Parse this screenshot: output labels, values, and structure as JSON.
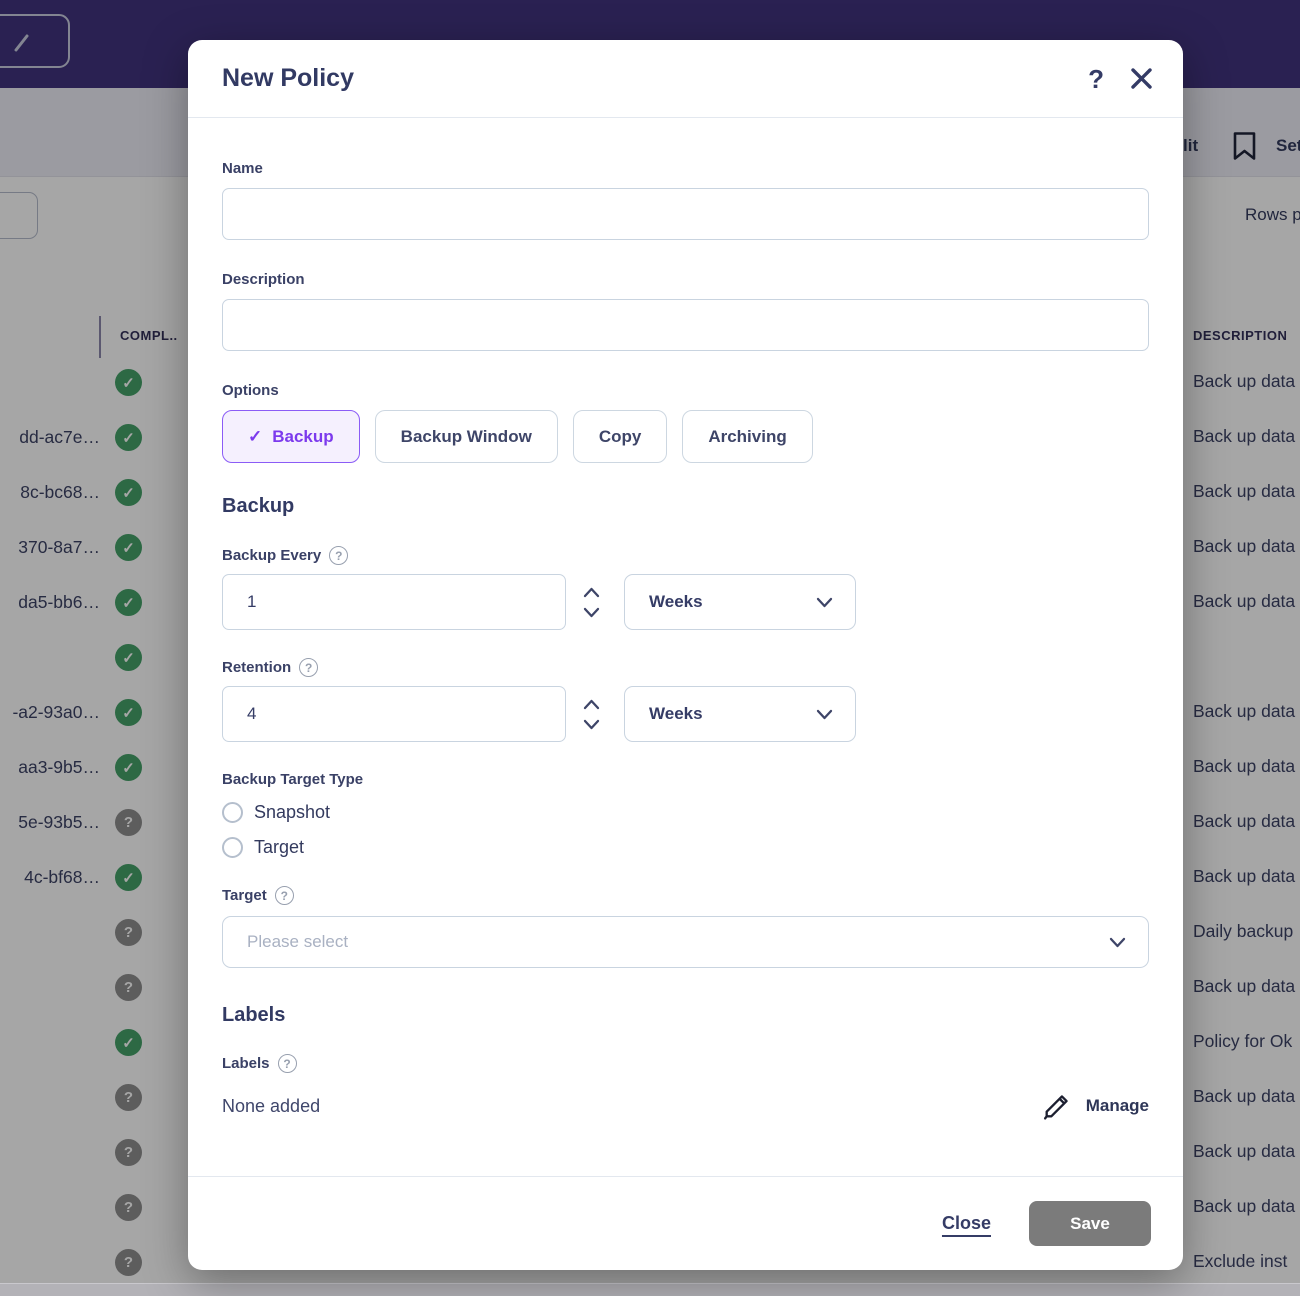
{
  "colors": {
    "accent": "#7c3aed",
    "accent_border": "#8b5cf6",
    "accent_bg": "#f5f0fe",
    "header_purple": "#41337e",
    "success_green": "#45a269",
    "unknown_gray": "#8f8f8f",
    "save_gray": "#7b7b7b"
  },
  "icons": {
    "help": "?",
    "check": "✓",
    "question": "?"
  },
  "modal": {
    "title": "New Policy",
    "name": {
      "label": "Name",
      "value": ""
    },
    "description": {
      "label": "Description",
      "value": ""
    },
    "options": {
      "label": "Options",
      "items": [
        {
          "label": "Backup",
          "selected": true
        },
        {
          "label": "Backup Window",
          "selected": false
        },
        {
          "label": "Copy",
          "selected": false
        },
        {
          "label": "Archiving",
          "selected": false
        }
      ]
    },
    "backup_section": {
      "heading": "Backup",
      "backup_every": {
        "label": "Backup Every",
        "value": "1",
        "unit": "Weeks"
      },
      "retention": {
        "label": "Retention",
        "value": "4",
        "unit": "Weeks"
      },
      "target_type": {
        "label": "Backup Target Type",
        "options": [
          {
            "label": "Snapshot",
            "checked": false
          },
          {
            "label": "Target",
            "checked": false
          }
        ]
      },
      "target": {
        "label": "Target",
        "placeholder": "Please select"
      }
    },
    "labels_section": {
      "heading": "Labels",
      "label": "Labels",
      "value": "None added",
      "manage": "Manage"
    },
    "footer": {
      "close": "Close",
      "save": "Save"
    }
  },
  "background": {
    "toolbar": {
      "edit_partial": "lit",
      "settings_partial": "Set",
      "rows_per_page_partial": "Rows p"
    },
    "table": {
      "columns": {
        "compliance": "COMPL..",
        "description": "DESCRIPTION"
      },
      "rows": [
        {
          "id": "",
          "status": "check",
          "description": "Back up data"
        },
        {
          "id": "dd-ac7e…",
          "status": "check",
          "description": "Back up data"
        },
        {
          "id": "8c-bc68…",
          "status": "check",
          "description": "Back up data"
        },
        {
          "id": "370-8a7…",
          "status": "check",
          "description": "Back up data"
        },
        {
          "id": "da5-bb6…",
          "status": "check",
          "description": "Back up data"
        },
        {
          "id": "",
          "status": "check",
          "description": ""
        },
        {
          "id": "-a2-93a0…",
          "status": "check",
          "description": "Back up data"
        },
        {
          "id": "aa3-9b5…",
          "status": "check",
          "description": "Back up data"
        },
        {
          "id": "5e-93b5…",
          "status": "unknown",
          "description": "Back up data"
        },
        {
          "id": "4c-bf68…",
          "status": "check",
          "description": "Back up data"
        },
        {
          "id": "",
          "status": "unknown",
          "description": "Daily backup"
        },
        {
          "id": "",
          "status": "unknown",
          "description": "Back up data"
        },
        {
          "id": "",
          "status": "check",
          "description": "Policy for Ok"
        },
        {
          "id": "",
          "status": "unknown",
          "description": "Back up data"
        },
        {
          "id": "",
          "status": "unknown",
          "description": "Back up data"
        },
        {
          "id": "",
          "status": "unknown",
          "description": "Back up data"
        },
        {
          "id": "",
          "status": "unknown",
          "description": "Exclude inst"
        }
      ]
    }
  }
}
